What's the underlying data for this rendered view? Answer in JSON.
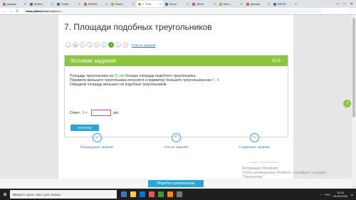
{
  "browser": {
    "tabs": [
      {
        "label": "Домаш",
        "color": "#e55"
      },
      {
        "label": "Вебин",
        "color": "#2a7abf"
      },
      {
        "label": "Ответ",
        "color": "#2a7abf"
      },
      {
        "label": "ЯКЛАС",
        "color": "#e55"
      },
      {
        "label": "Какие",
        "color": "#8cc63f"
      },
      {
        "label": "7. Пло",
        "color": "#8cc63f",
        "active": true
      },
      {
        "label": "Конст",
        "color": "#2a7abf"
      },
      {
        "label": "Обла",
        "color": "#c04fb0"
      },
      {
        "label": "Как п",
        "color": "#8cc63f"
      },
      {
        "label": "Домаш",
        "color": "#e55"
      },
      {
        "label": "ВКЛЮ",
        "color": "#2a7abf"
      }
    ],
    "url_domain": "www.yaklass.ru",
    "url_rest": "/p/algebra/...",
    "window_controls": [
      "—",
      "□",
      "✕"
    ]
  },
  "page": {
    "title": "7. Площади подобных треугольников",
    "pager": {
      "numbers": [
        "1",
        "2",
        "3",
        "4",
        "5",
        "6",
        "7",
        "8",
        "9"
      ],
      "current": "2",
      "done": "7",
      "link": "Список заданий"
    },
    "task": {
      "header": "Условие задания:",
      "points": "15 Б.",
      "line1_a": "Площадь треугольника на ",
      "line1_hl": "21 см²",
      "line1_b": " больше площади подобного треугольника.",
      "line2_a": "Периметр меньшего треугольника относится к периметру большего треугольника как ",
      "line2_hl": "3 : 4",
      "line2_b": ".",
      "line3": "Определи площадь меньшего из подобных треугольников.",
      "answer_label": "Ответ:",
      "answer_symbol": "S =",
      "answer_value": "",
      "answer_unit": "см².",
      "submit": "Ответить!"
    },
    "nav": {
      "prev": "Предыдущее задание",
      "list": "Список заданий",
      "next": "Следующее задание"
    },
    "copyright": "Copyright © 2011–2020 ЯКласс",
    "schedule_button": "Перейти к расписанию",
    "feedback_icon": "?"
  },
  "watermark": {
    "title": "Активация Windows",
    "line1": "Чтобы активировать Windows, перейдите в раздел",
    "line2": "\"Параметры\"."
  },
  "taskbar": {
    "search_placeholder": "Введите здесь текст для поиска",
    "time": "15:12",
    "date": "03.04.2020",
    "lang": "РУС",
    "icons": [
      "#3a76c4",
      "#ffcc33",
      "#0078d7",
      "#e55",
      "#3a9a3a",
      "#ff8800",
      "#777"
    ]
  }
}
